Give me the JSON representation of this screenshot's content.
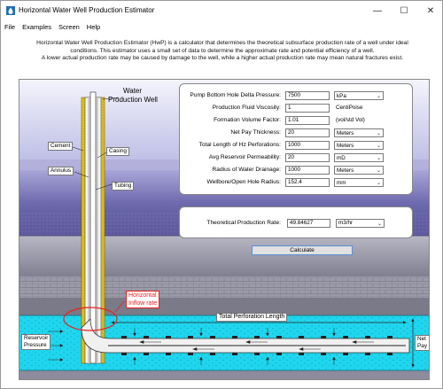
{
  "window": {
    "title": "Horizontal Water Well Production Estimator",
    "icon": "water-drop-app-icon",
    "controls": {
      "minimize": "—",
      "maximize": "☐",
      "close": "✕"
    }
  },
  "menu": [
    "File",
    "Examples",
    "Screen",
    "Help"
  ],
  "description": [
    "Horizontal Water Well Production Estimator (HwP) is a calculator that determines the theoretical subsurface production rate of a well under ideal",
    "conditions. This estimator uses a small set of data to determine the approximate rate and potential efficiency of a well.",
    "A lower actual production rate may be caused by damage to the well, while a higher actual production rate may mean natural fractures exist."
  ],
  "diagram_labels": {
    "production_well_1": "Water",
    "production_well_2": "Production Well",
    "cement": "Cement",
    "casing": "Casing",
    "annulus": "Annulus",
    "tubing": "Tubing",
    "horizontal_inflow_1": "Horizontal",
    "horizontal_inflow_2": "Inflow rate",
    "total_perforation_length": "Total Perforation Length",
    "reservoir_pressure_1": "Reservoir",
    "reservoir_pressure_2": "Pressure",
    "net_pay_1": "Net",
    "net_pay_2": "Pay"
  },
  "inputs": [
    {
      "label": "Pump Bottom Hole Delta Pressure:",
      "value": "7500",
      "unit": "kPa",
      "unit_is_select": true
    },
    {
      "label": "Production Fluid Viscosity:",
      "value": "1",
      "unit": "CentiPoise",
      "unit_is_select": false
    },
    {
      "label": "Formation Volume Factor:",
      "value": "1.01",
      "unit": "(vol/std Vol)",
      "unit_is_select": false
    },
    {
      "label": "Net Pay Thickness:",
      "value": "20",
      "unit": "Meters",
      "unit_is_select": true
    },
    {
      "label": "Total Length of Hz Perforations:",
      "value": "1000",
      "unit": "Meters",
      "unit_is_select": true
    },
    {
      "label": "Avg Reservoir Permeability:",
      "value": "20",
      "unit": "mD",
      "unit_is_select": true
    },
    {
      "label": "Radius of Water Drainage:",
      "value": "1000",
      "unit": "Meters",
      "unit_is_select": true
    },
    {
      "label": "Wellbore/Open Hole Radius:",
      "value": "152.4",
      "unit": "mm",
      "unit_is_select": true
    }
  ],
  "result": {
    "label": "Theoretical Production Rate:",
    "value": "49.84627",
    "unit": "m3/hr"
  },
  "calculate_label": "Calculate",
  "colors": {
    "sky_top": "#cfd0ee",
    "formation_purple": "#6b67ab",
    "formation_dark": "#4b4786",
    "rock_gray": "#8c8c9c",
    "water_cyan": "#19d6ee",
    "casing_yellow": "#e2c21a",
    "annotation_red": "#e8221f"
  }
}
